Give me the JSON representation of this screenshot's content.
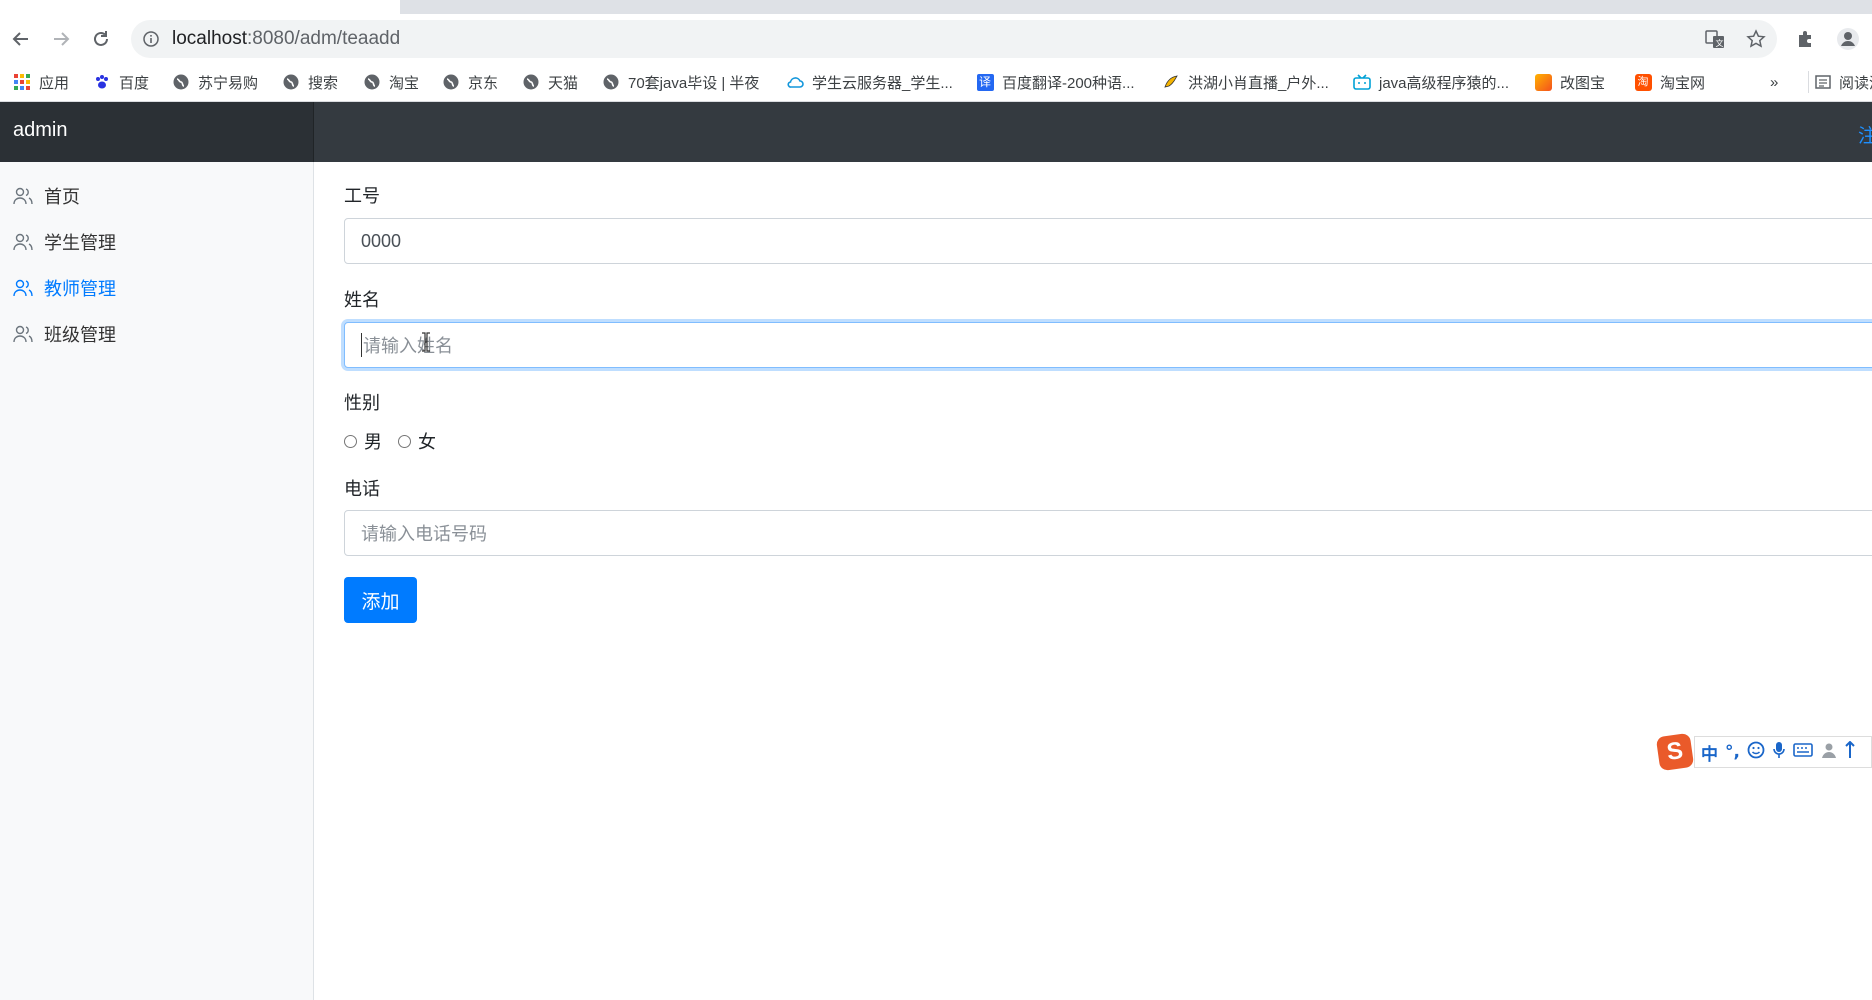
{
  "browser": {
    "url_host": "localhost",
    "url_path": ":8080/adm/teaadd",
    "bookmarks": [
      {
        "label": "应用",
        "icon": "apps-grid-icon"
      },
      {
        "label": "百度",
        "icon": "baidu-paw-icon"
      },
      {
        "label": "苏宁易购",
        "icon": "globe-icon"
      },
      {
        "label": "搜索",
        "icon": "globe-icon"
      },
      {
        "label": "淘宝",
        "icon": "globe-icon"
      },
      {
        "label": "京东",
        "icon": "globe-icon"
      },
      {
        "label": "天猫",
        "icon": "globe-icon"
      },
      {
        "label": "70套java毕设 | 半夜",
        "icon": "globe-icon"
      },
      {
        "label": "学生云服务器_学生...",
        "icon": "cloud-icon"
      },
      {
        "label": "百度翻译-200种语...",
        "icon": "translate-icon"
      },
      {
        "label": "洪湖小肖直播_户外...",
        "icon": "bird-icon"
      },
      {
        "label": "java高级程序猿的...",
        "icon": "bilibili-tv-icon"
      },
      {
        "label": "改图宝",
        "icon": "gaitubao-icon"
      },
      {
        "label": "淘宝网",
        "icon": "taobao-icon"
      }
    ],
    "overflow_label": "»",
    "reading_list": "阅读清"
  },
  "app": {
    "brand": "admin",
    "header_link": "注"
  },
  "sidebar": {
    "items": [
      {
        "label": "首页",
        "active": false
      },
      {
        "label": "学生管理",
        "active": false
      },
      {
        "label": "教师管理",
        "active": true
      },
      {
        "label": "班级管理",
        "active": false
      }
    ]
  },
  "form": {
    "id_label": "工号",
    "id_value": "0000",
    "name_label": "姓名",
    "name_placeholder": "请输入姓名",
    "gender_label": "性别",
    "gender_options": [
      "男",
      "女"
    ],
    "phone_label": "电话",
    "phone_placeholder": "请输入电话号码",
    "submit_label": "添加"
  },
  "ime": {
    "logo": "S",
    "mode": "中",
    "punct": "°,"
  },
  "colors": {
    "primary": "#007bff",
    "header_bg": "#343a40",
    "brand_bg": "#2b3035",
    "sidebar_bg": "#f8f9fa"
  }
}
